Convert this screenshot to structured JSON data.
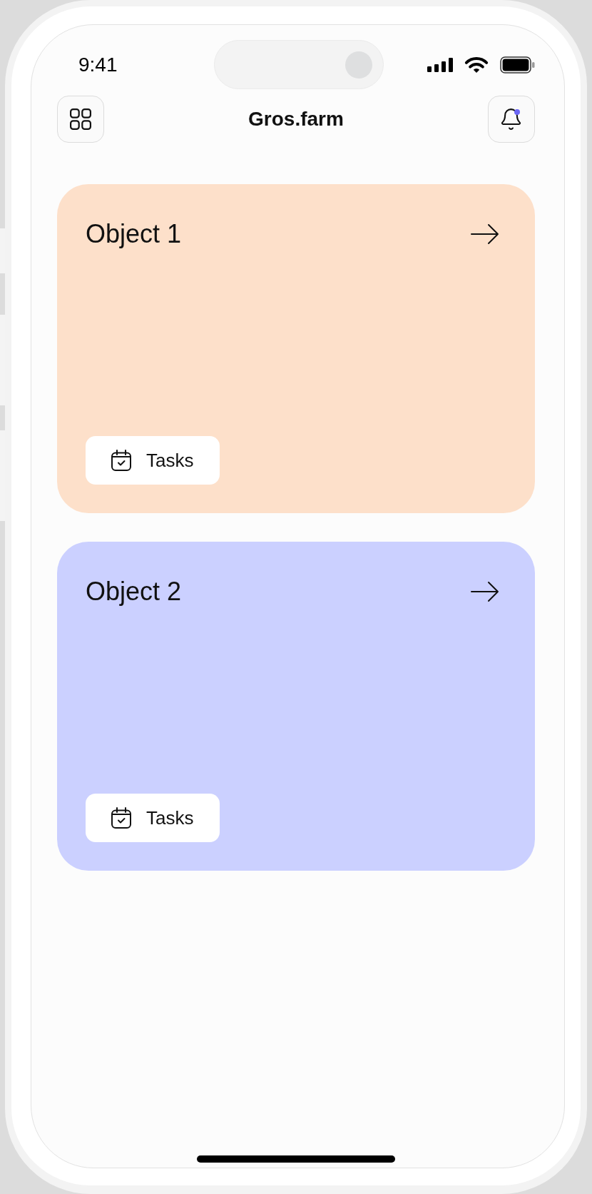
{
  "status_bar": {
    "time": "9:41"
  },
  "header": {
    "title": "Gros.farm",
    "notifications": {
      "unread": true
    }
  },
  "objects": [
    {
      "name": "Object 1",
      "color": "#fde0ca",
      "action": "Tasks"
    },
    {
      "name": "Object 2",
      "color": "#cbd0ff",
      "action": "Tasks"
    }
  ]
}
